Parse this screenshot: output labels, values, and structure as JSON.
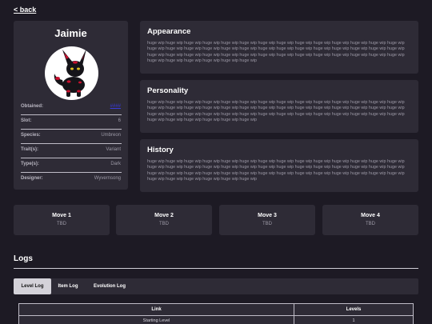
{
  "nav": {
    "back_label": "< back"
  },
  "profile": {
    "name": "Jaimie",
    "portrait_icon": "umbreon-portrait",
    "rows": [
      {
        "key": "Obtained:",
        "value": "####",
        "is_link": true
      },
      {
        "key": "Slot:",
        "value": "6"
      },
      {
        "key": "Species:",
        "value": "Umbreon"
      },
      {
        "key": "Trait(s):",
        "value": "Variant"
      },
      {
        "key": "Type(s):",
        "value": "Dark"
      },
      {
        "key": "Designer:",
        "value": "Wyvernsong"
      }
    ]
  },
  "sections": {
    "appearance": {
      "title": "Appearance",
      "body": "huge wip huge wip huge wip huge wip huge wip huge wip huge wip huge wip huge wip huge wip huge wip huge wip huge wip huge wip huge wip huge wip huge wip huge wip huge wip huge wip huge wip huge wip huge wip huge wip huge wip huge wip huge wip huge wip huge wip huge wip huge wip huge wip huge wip huge wip huge wip huge wip huge wip huge wip huge wip huge wip huge wip huge wip huge wip huge wip huge wip huge wip huge wip huge wip"
    },
    "personality": {
      "title": "Personality",
      "body": "huge wip huge wip huge wip huge wip huge wip huge wip huge wip huge wip huge wip huge wip huge wip huge wip huge wip huge wip huge wip huge wip huge wip huge wip huge wip huge wip huge wip huge wip huge wip huge wip huge wip huge wip huge wip huge wip huge wip huge wip huge wip huge wip huge wip huge wip huge wip huge wip huge wip huge wip huge wip huge wip huge wip huge wip huge wip huge wip huge wip huge wip huge wip huge wip"
    },
    "history": {
      "title": "History",
      "body": "huge wip huge wip huge wip huge wip huge wip huge wip huge wip huge wip huge wip huge wip huge wip huge wip huge wip huge wip huge wip huge wip huge wip huge wip huge wip huge wip huge wip huge wip huge wip huge wip huge wip huge wip huge wip huge wip huge wip huge wip huge wip huge wip huge wip huge wip huge wip huge wip huge wip huge wip huge wip huge wip huge wip huge wip huge wip huge wip huge wip huge wip huge wip huge wip"
    }
  },
  "moves": [
    {
      "name": "Move 1",
      "desc": "TBD"
    },
    {
      "name": "Move 2",
      "desc": "TBD"
    },
    {
      "name": "Move 3",
      "desc": "TBD"
    },
    {
      "name": "Move 4",
      "desc": "TBD"
    }
  ],
  "logs": {
    "title": "Logs",
    "tabs": [
      "Level Log",
      "Item Log",
      "Evolution Log"
    ],
    "active_tab": "Level Log",
    "table": {
      "headers": [
        "Link",
        "Levels"
      ],
      "rows": [
        {
          "link": "Starting Level",
          "levels": "1"
        }
      ]
    }
  },
  "colors": {
    "background": "#1d1a24",
    "card": "#2e2b36",
    "link": "#3a3adc",
    "active_tab": "#d4d2d9"
  }
}
